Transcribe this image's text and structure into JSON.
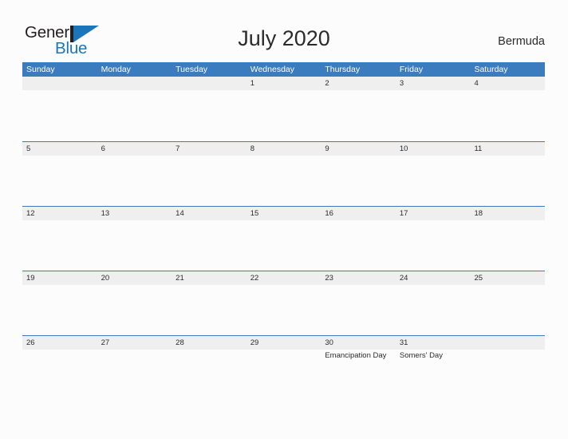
{
  "brand": {
    "word_one": "General",
    "word_two": "Blue",
    "mark": "flag-triangle-icon",
    "dark_color": "#231f20",
    "blue_color": "#1b75bb"
  },
  "header": {
    "title": "July 2020",
    "region": "Bermuda"
  },
  "colors": {
    "header_blue": "#3b7cbf",
    "day_band_gray": "#efefef",
    "page_background": "#fcfcfc",
    "text": "#2b2b2b"
  },
  "calendar": {
    "weekdays": [
      "Sunday",
      "Monday",
      "Tuesday",
      "Wednesday",
      "Thursday",
      "Friday",
      "Saturday"
    ],
    "weeks": [
      [
        {
          "num": "",
          "events": []
        },
        {
          "num": "",
          "events": []
        },
        {
          "num": "",
          "events": []
        },
        {
          "num": "1",
          "events": []
        },
        {
          "num": "2",
          "events": []
        },
        {
          "num": "3",
          "events": []
        },
        {
          "num": "4",
          "events": []
        }
      ],
      [
        {
          "num": "5",
          "events": []
        },
        {
          "num": "6",
          "events": []
        },
        {
          "num": "7",
          "events": []
        },
        {
          "num": "8",
          "events": []
        },
        {
          "num": "9",
          "events": []
        },
        {
          "num": "10",
          "events": []
        },
        {
          "num": "11",
          "events": []
        }
      ],
      [
        {
          "num": "12",
          "events": []
        },
        {
          "num": "13",
          "events": []
        },
        {
          "num": "14",
          "events": []
        },
        {
          "num": "15",
          "events": []
        },
        {
          "num": "16",
          "events": []
        },
        {
          "num": "17",
          "events": []
        },
        {
          "num": "18",
          "events": []
        }
      ],
      [
        {
          "num": "19",
          "events": []
        },
        {
          "num": "20",
          "events": []
        },
        {
          "num": "21",
          "events": []
        },
        {
          "num": "22",
          "events": []
        },
        {
          "num": "23",
          "events": []
        },
        {
          "num": "24",
          "events": []
        },
        {
          "num": "25",
          "events": []
        }
      ],
      [
        {
          "num": "26",
          "events": []
        },
        {
          "num": "27",
          "events": []
        },
        {
          "num": "28",
          "events": []
        },
        {
          "num": "29",
          "events": []
        },
        {
          "num": "30",
          "events": [
            "Emancipation Day"
          ]
        },
        {
          "num": "31",
          "events": [
            "Somers' Day"
          ]
        },
        {
          "num": "",
          "events": []
        }
      ]
    ]
  }
}
